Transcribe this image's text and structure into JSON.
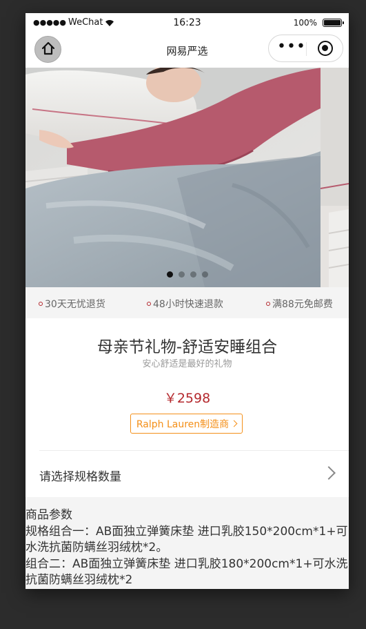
{
  "status_bar": {
    "signal_dots": "●●●●●",
    "carrier": "WeChat",
    "time": "16:23",
    "battery_percent": "100%",
    "battery_level": 1.0
  },
  "nav": {
    "title": "网易严选",
    "home_icon": "home-icon",
    "more_icon": "more-dots-icon",
    "close_icon": "miniprogram-close-icon"
  },
  "banner": {
    "slide_count": 4,
    "active_index": 0
  },
  "services": [
    {
      "label": "30天无忧退货"
    },
    {
      "label": "48小时快速退款"
    },
    {
      "label": "满88元免邮费"
    }
  ],
  "product": {
    "title": "母亲节礼物-舒适安睡组合",
    "subtitle": "安心舒适是最好的礼物",
    "price": "￥2598",
    "brand_tag": "Ralph Lauren制造商"
  },
  "spec": {
    "label": "请选择规格数量"
  },
  "params": {
    "heading": "商品参数",
    "lines": [
      "规格组合一：AB面独立弹簧床垫 进口乳胶150*200cm*1+可",
      "水洗抗菌防螨丝羽绒枕*2。",
      "组合二：AB面独立弹簧床垫 进口乳胶180*200cm*1+可水洗",
      "抗菌防螨丝羽绒枕*2"
    ]
  },
  "colors": {
    "accent_red": "#b4282d",
    "brand_orange": "#f48f18"
  }
}
